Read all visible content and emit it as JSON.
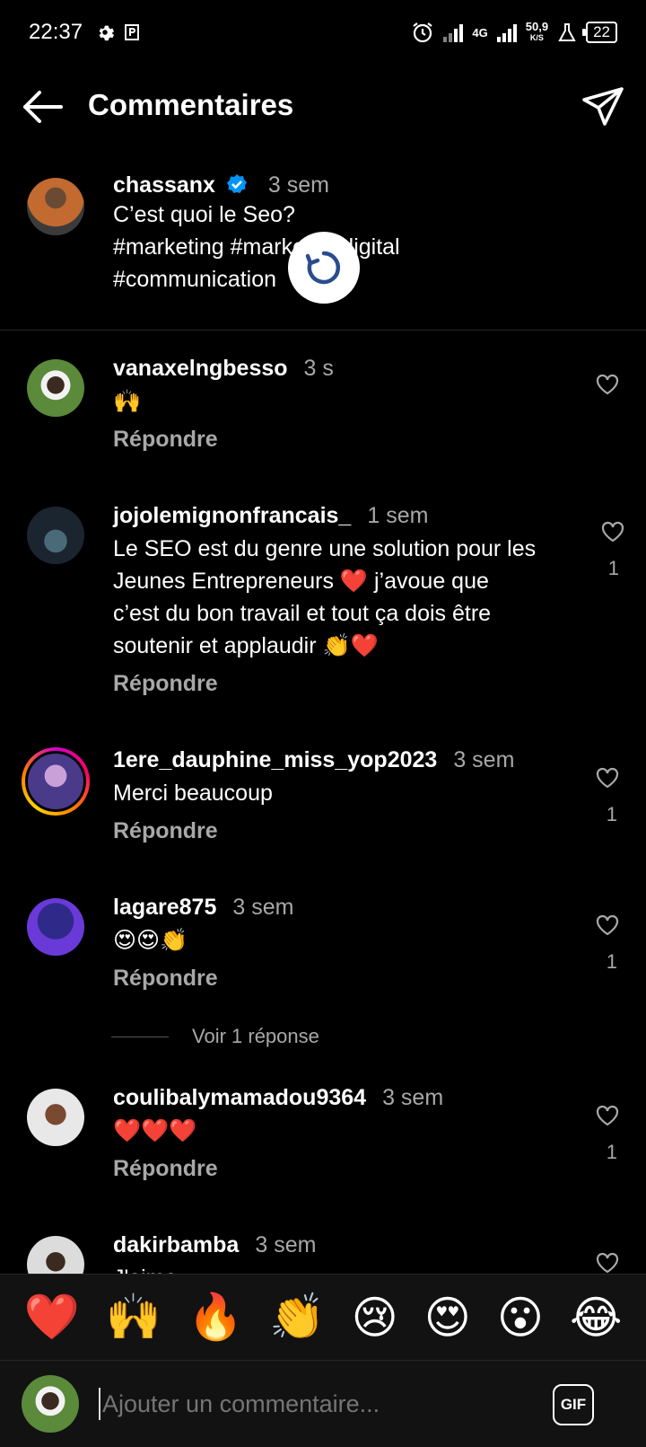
{
  "status_bar": {
    "time": "22:37",
    "network_4g": "4G",
    "speed": "50,9",
    "speed_unit": "K/S",
    "battery": "22"
  },
  "header": {
    "title": "Commentaires"
  },
  "caption": {
    "username": "chassanx",
    "time": "3 sem",
    "line1": "C’est quoi le Seo?",
    "line2": "#marketing #marketingdigital",
    "line3": "#communication"
  },
  "comments": [
    {
      "username": "vanaxelngbesso",
      "time": "3 s",
      "text": "🙌",
      "reply": "Répondre",
      "likes": ""
    },
    {
      "username": "jojolemignonfrancais_",
      "time": "1 sem",
      "text_lines": [
        "Le SEO est du genre une solution pour les",
        "Jeunes Entrepreneurs ❤️ j’avoue que",
        "c’est du bon travail et tout ça dois être",
        "soutenir et applaudir 👏❤️"
      ],
      "reply": "Répondre",
      "likes": "1"
    },
    {
      "username": "1ere_dauphine_miss_yop2023",
      "time": "3 sem",
      "text": "Merci beaucoup",
      "reply": "Répondre",
      "likes": "1"
    },
    {
      "username": "lagare875",
      "time": "3 sem",
      "text": "😍😍👏",
      "reply": "Répondre",
      "likes": "1"
    },
    {
      "username": "coulibalymamadou9364",
      "time": "3 sem",
      "text": "❤️❤️❤️",
      "reply": "Répondre",
      "likes": "1"
    },
    {
      "username": "dakirbamba",
      "time": "3 sem",
      "text": "J'aime",
      "reply": "",
      "likes": ""
    }
  ],
  "view_replies": "Voir 1 réponse",
  "emoji_bar": [
    "❤️",
    "🙌",
    "🔥",
    "👏",
    "😢",
    "😍",
    "😮",
    "😂"
  ],
  "composer": {
    "placeholder": "Ajouter un commentaire...",
    "gif_label": "GIF"
  },
  "colors": {
    "background": "#000000",
    "secondary_text": "#a8a8a8",
    "verified_blue": "#0095f6",
    "bar_background": "#121212"
  }
}
